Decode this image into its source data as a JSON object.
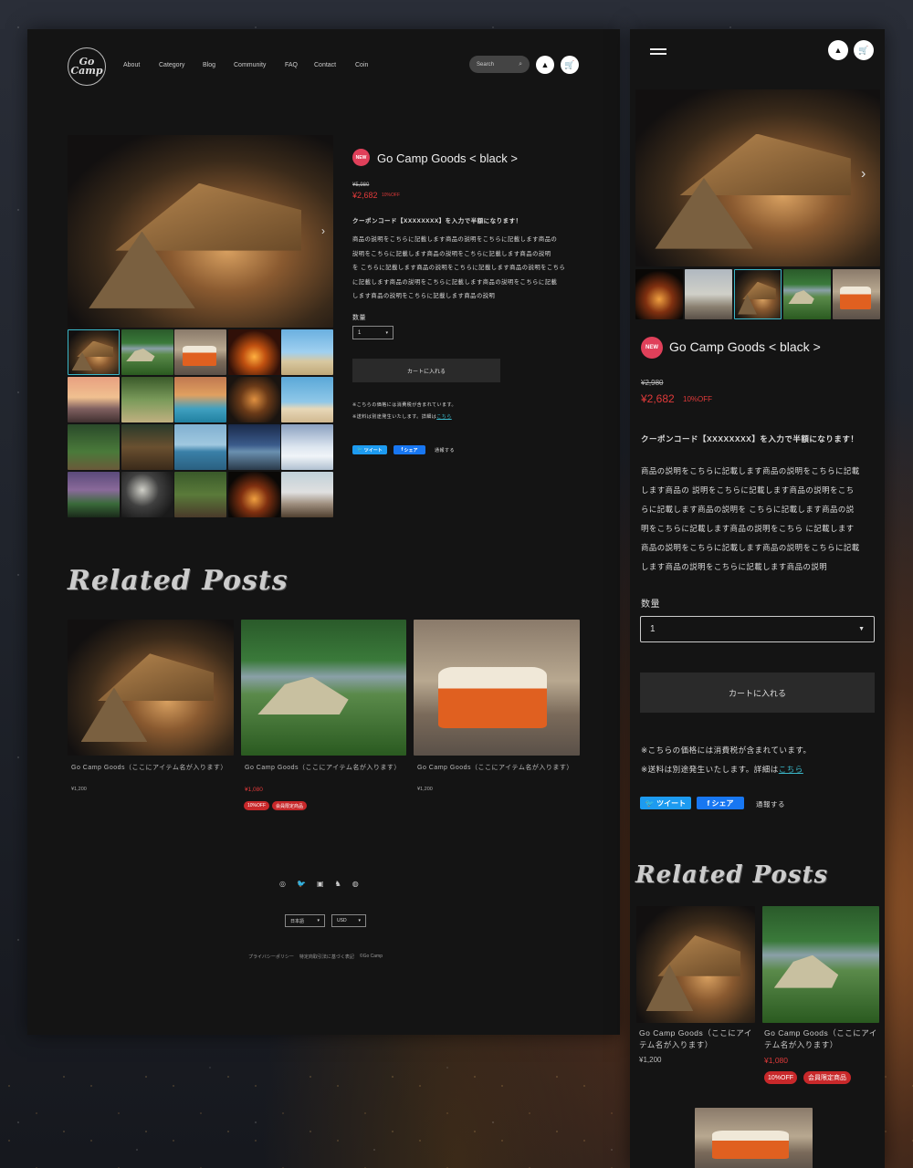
{
  "logo": {
    "line1": "Go",
    "line2": "Camp"
  },
  "nav": [
    "About",
    "Category",
    "Blog",
    "Community",
    "FAQ",
    "Contact",
    "Coin"
  ],
  "search": {
    "placeholder": "Search"
  },
  "product": {
    "badge": "NEW",
    "title": "Go Camp Goods < black >",
    "old_price_desktop": "¥5,980",
    "old_price_mobile": "¥2,980",
    "price": "¥2,682",
    "discount": "10%OFF",
    "coupon": "クーポンコード【XXXXXXXX】を入力で半額になります！",
    "desc_desktop": [
      "商品の説明をこちらに記載します商品の説明をこちらに記載します商品の",
      "説明をこちらに記載します商品の説明をこちらに記載します商品の説明",
      "を こちらに記載します商品の説明をこちらに記載します商品の説明をこちら",
      "に記載します商品の説明をこちらに記載します商品の説明をこちらに記載",
      "します商品の説明をこちらに記載します商品の説明"
    ],
    "desc_mobile": [
      "商品の説明をこちらに記載します商品の説明をこちらに記載",
      "します商品の 説明をこちらに記載します商品の説明をこち",
      "らに記載します商品の説明を こちらに記載します商品の説",
      "明をこちらに記載します商品の説明をこちら に記載します",
      "商品の説明をこちらに記載します商品の説明をこちらに記載",
      "します商品の説明をこちらに記載します商品の説明"
    ],
    "qty_label": "数量",
    "qty_value": "1",
    "cart_button": "カートに入れる",
    "tax_note": "※こちらの価格には消費税が含まれています。",
    "shipping_note": "※送料は別途発生いたします。詳細は",
    "shipping_link": "こちら",
    "tweet": "ツイート",
    "share": "シェア",
    "report": "通報する"
  },
  "related": {
    "heading": "Related Posts",
    "items": [
      {
        "name": "Go Camp Goods（ここにアイテム名が入ります）",
        "price": "¥1,200",
        "tags": []
      },
      {
        "name": "Go Camp Goods（ここにアイテム名が入ります）",
        "price": "¥1,080",
        "tags": [
          "10%OFF",
          "会員限定商品"
        ]
      },
      {
        "name": "Go Camp Goods（ここにアイテム名が入ります）",
        "price": "¥1,200",
        "tags": []
      }
    ]
  },
  "footer": {
    "social_icons": [
      "instagram-icon",
      "twitter-icon",
      "facebook-icon",
      "suzuri-icon",
      "line-icon"
    ],
    "language": "日本語",
    "currency": "USD",
    "links": [
      "プライバシーポリシー",
      "特定商取引法に基づく表記",
      "©Go Camp"
    ]
  },
  "colors": {
    "accent": "#e0405a",
    "sale": "#e03a3a",
    "link": "#3ab7c8",
    "panel": "#141414"
  }
}
